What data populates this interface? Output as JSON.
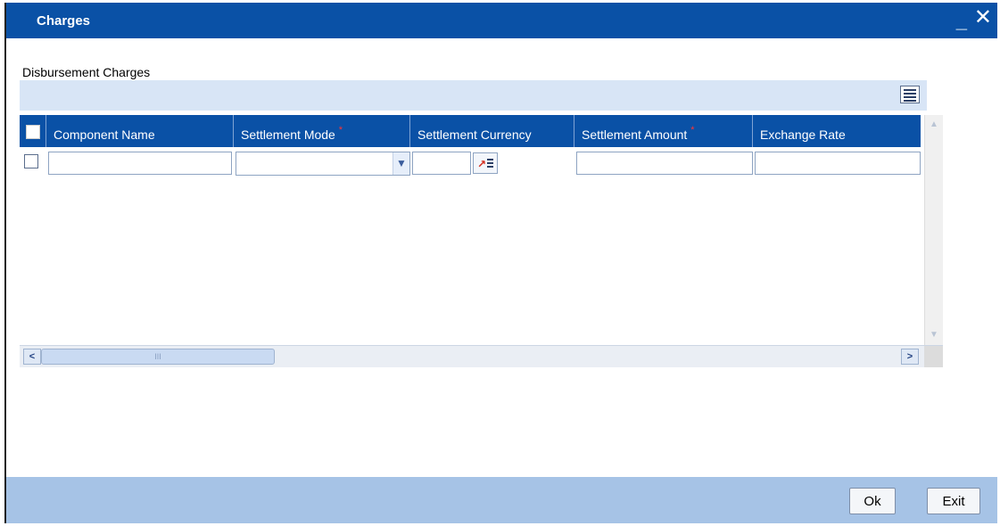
{
  "window": {
    "title": "Charges",
    "minimize_glyph": "_",
    "close_glyph": "✕"
  },
  "section": {
    "label": "Disbursement Charges"
  },
  "toolbar": {
    "grid_icon": "list-view-icon"
  },
  "table": {
    "columns": [
      {
        "label": "Component Name",
        "required": false
      },
      {
        "label": "Settlement Mode",
        "required": true
      },
      {
        "label": "Settlement Currency",
        "required": false
      },
      {
        "label": "Settlement Amount",
        "required": true
      },
      {
        "label": "Exchange Rate",
        "required": false
      }
    ],
    "required_marker": "*",
    "rows": [
      {
        "component_name": "",
        "settlement_mode": "",
        "settlement_currency": "",
        "settlement_amount": "",
        "exchange_rate": ""
      }
    ]
  },
  "scrollbar": {
    "left_glyph": "<",
    "right_glyph": ">",
    "thumb_glyph": "III"
  },
  "footer": {
    "ok_label": "Ok",
    "exit_label": "Exit"
  },
  "colors": {
    "titlebar": "#0a51a6",
    "footer": "#a6c3e6",
    "toolbar_strip": "#d8e5f6",
    "required": "#ff3333"
  }
}
